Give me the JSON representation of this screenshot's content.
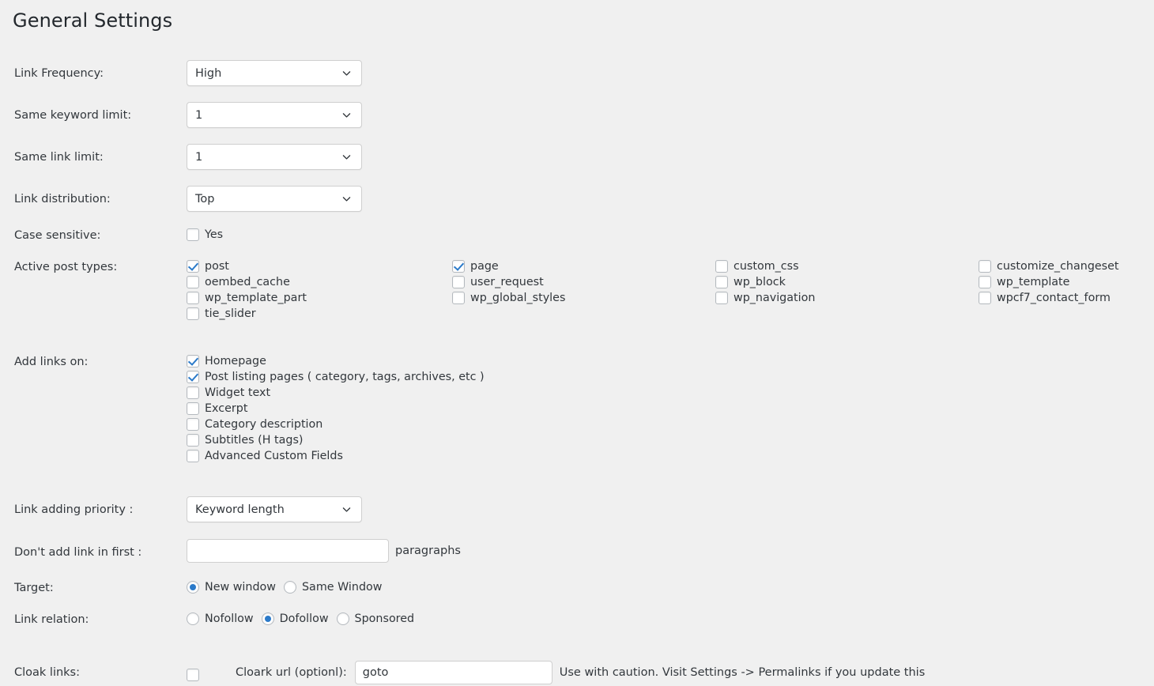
{
  "page": {
    "title": "General Settings",
    "accent_color": "#2b7ac9",
    "background_color": "#f0f0f0",
    "text_color": "#32373c"
  },
  "fields": {
    "link_frequency": {
      "label": "Link Frequency:",
      "value": "High"
    },
    "same_keyword_limit": {
      "label": "Same keyword limit:",
      "value": "1"
    },
    "same_link_limit": {
      "label": "Same link limit:",
      "value": "1"
    },
    "link_distribution": {
      "label": "Link distribution:",
      "value": "Top"
    },
    "case_sensitive": {
      "label": "Case sensitive:",
      "option": "Yes",
      "checked": false
    },
    "active_post_types": {
      "label": "Active post types:"
    },
    "add_links_on": {
      "label": "Add links on:"
    },
    "link_adding_priority": {
      "label": "Link adding priority :",
      "value": "Keyword length"
    },
    "dont_add_link_in_first": {
      "label": "Don't add link in first :",
      "value": "",
      "placeholder": "",
      "suffix": "paragraphs"
    },
    "target": {
      "label": "Target:"
    },
    "link_relation": {
      "label": "Link relation:"
    },
    "cloak_links": {
      "label": "Cloak links:",
      "checked": false,
      "url_label": "Cloark url (optionl):",
      "url_value": "goto",
      "note": "Use with caution. Visit Settings -> Permalinks if you update this"
    }
  },
  "post_types": [
    {
      "label": "post",
      "checked": true
    },
    {
      "label": "oembed_cache",
      "checked": false
    },
    {
      "label": "wp_template_part",
      "checked": false
    },
    {
      "label": "tie_slider",
      "checked": false
    },
    {
      "label": "page",
      "checked": true
    },
    {
      "label": "user_request",
      "checked": false
    },
    {
      "label": "wp_global_styles",
      "checked": false
    },
    {
      "label": "custom_css",
      "checked": false
    },
    {
      "label": "wp_block",
      "checked": false
    },
    {
      "label": "wp_navigation",
      "checked": false
    },
    {
      "label": "customize_changeset",
      "checked": false
    },
    {
      "label": "wp_template",
      "checked": false
    },
    {
      "label": "wpcf7_contact_form",
      "checked": false
    }
  ],
  "add_links_options": [
    {
      "label": "Homepage",
      "checked": true
    },
    {
      "label": "Post listing pages ( category, tags, archives, etc )",
      "checked": true
    },
    {
      "label": "Widget text",
      "checked": false
    },
    {
      "label": "Excerpt",
      "checked": false
    },
    {
      "label": "Category description",
      "checked": false
    },
    {
      "label": "Subtitles (H tags)",
      "checked": false
    },
    {
      "label": "Advanced Custom Fields",
      "checked": false
    }
  ],
  "target_options": [
    {
      "label": "New window",
      "checked": true
    },
    {
      "label": "Same Window",
      "checked": false
    }
  ],
  "link_relation_options": [
    {
      "label": "Nofollow",
      "checked": false
    },
    {
      "label": "Dofollow",
      "checked": true
    },
    {
      "label": "Sponsored",
      "checked": false
    }
  ],
  "icons": {
    "chevron": "chevron-down-icon",
    "check": "checkmark-icon"
  }
}
